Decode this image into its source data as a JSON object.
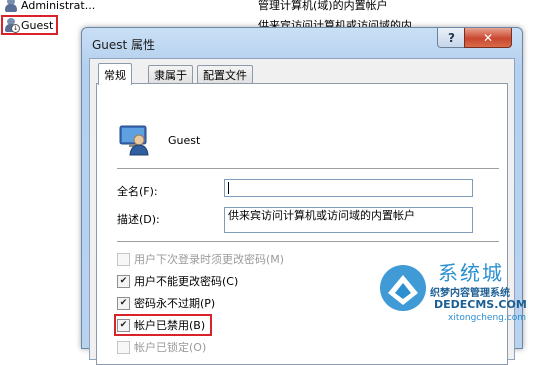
{
  "background": {
    "rows": [
      {
        "name": "Administrat...",
        "desc": "管理计算机(域)的内置帐户"
      },
      {
        "name": "Guest",
        "desc": "供来宾访问计算机或访问域的内"
      }
    ]
  },
  "dialog": {
    "title": "Guest 属性",
    "help": "?",
    "close": "✕",
    "tabs": [
      "常规",
      "隶属于",
      "配置文件"
    ],
    "user_name": "Guest",
    "fullname_label": "全名(F):",
    "fullname_value": "",
    "desc_label": "描述(D):",
    "desc_value": "供来宾访问计算机或访问域的内置帐户",
    "options": [
      {
        "label": "用户下次登录时须更改密码(M)",
        "checked": false,
        "enabled": false
      },
      {
        "label": "用户不能更改密码(C)",
        "checked": true,
        "enabled": true
      },
      {
        "label": "密码永不过期(P)",
        "checked": true,
        "enabled": true
      },
      {
        "label": "帐户已禁用(B)",
        "checked": true,
        "enabled": true
      },
      {
        "label": "帐户已锁定(O)",
        "checked": false,
        "enabled": false
      }
    ]
  },
  "watermark": {
    "big": "系统城",
    "small": "织梦内容管理系统",
    "url": "DEDECMS.COM",
    "sub": "xitongcheng.com"
  },
  "colors": {
    "highlight": "#d9232a",
    "title_bar": "#b9d3ef"
  }
}
